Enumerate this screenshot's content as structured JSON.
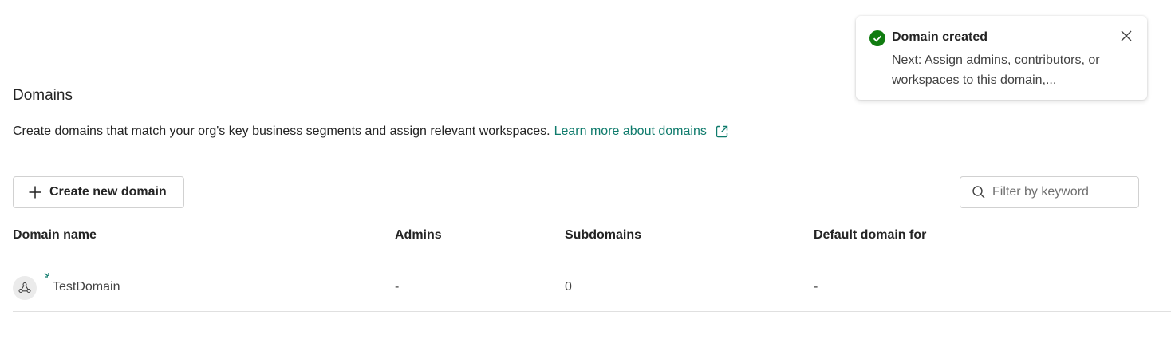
{
  "section": {
    "title": "Domains",
    "description": "Create domains that match your org's key business segments and assign relevant workspaces.",
    "learn_more_link": "Learn more about domains"
  },
  "toolbar": {
    "create_label": "Create new domain",
    "filter_placeholder": "Filter by keyword"
  },
  "table": {
    "columns": [
      "Domain name",
      "Admins",
      "Subdomains",
      "Default domain for"
    ],
    "rows": [
      {
        "name": "TestDomain",
        "admins": "-",
        "subdomains": "0",
        "default_for": "-"
      }
    ]
  },
  "toast": {
    "title": "Domain created",
    "message": "Next: Assign admins, contributors, or workspaces to this domain,...",
    "status_color": "#107c10"
  },
  "colors": {
    "link": "#0f7b6c",
    "sparkle": "#0f7b6c"
  }
}
